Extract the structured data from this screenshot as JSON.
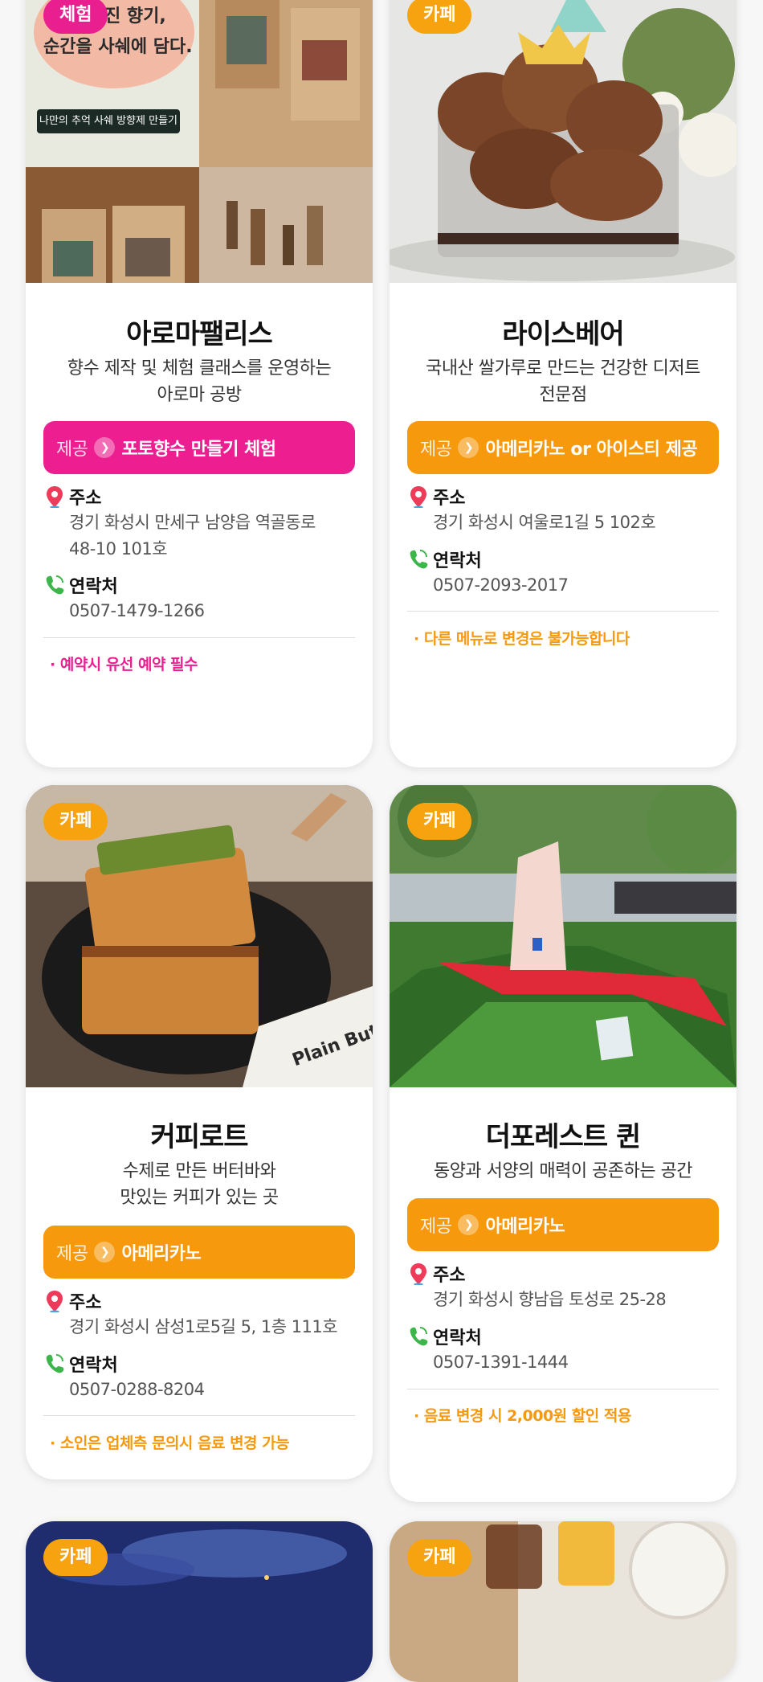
{
  "cards": [
    {
      "tag": "체험",
      "photo_caption_line1": "진 향기,",
      "photo_caption_line2": "순간을 사쉐에 담다.",
      "photo_button": "나만의 추억 사쉐 방향제 만들기",
      "title": "아로마팰리스",
      "desc_line1": "향수 제작 및 체험 클래스를 운영하는",
      "desc_line2": "아로마 공방",
      "offer_label": "제공",
      "offer_text": "포토향수 만들기 체험",
      "address_label": "주소",
      "address_line1": "경기 화성시 만세구 남양읍 역골동로",
      "address_line2": "48-10 101호",
      "contact_label": "연락처",
      "contact": "0507-1479-1266",
      "note": "· 예약시 유선 예약 필수"
    },
    {
      "tag": "카페",
      "title": "라이스베어",
      "desc_line1": "국내산 쌀가루로 만드는 건강한 디저트",
      "desc_line2": "전문점",
      "offer_label": "제공",
      "offer_text": "아메리카노 or 아이스티 제공",
      "address_label": "주소",
      "address_line1": "경기 화성시 여울로1길 5 102호",
      "contact_label": "연락처",
      "contact": "0507-2093-2017",
      "note": "· 다른 메뉴로 변경은 불가능합니다"
    },
    {
      "tag": "카페",
      "photo_text": "Plain Butter Bo",
      "title": "커피로트",
      "desc_line1": "수제로 만든 버터바와",
      "desc_line2": "맛있는 커피가 있는 곳",
      "offer_label": "제공",
      "offer_text": "아메리카노",
      "address_label": "주소",
      "address_line1": "경기 화성시 삼성1로5길 5, 1층 111호",
      "contact_label": "연락처",
      "contact": "0507-0288-8204",
      "note": "· 소인은 업체측 문의시 음료 변경 가능"
    },
    {
      "tag": "카페",
      "title": "더포레스트 퀸",
      "desc_line1": "동양과 서양의 매력이 공존하는 공간",
      "offer_label": "제공",
      "offer_text": "아메리카노",
      "address_label": "주소",
      "address_line1": "경기 화성시 향남읍 토성로 25-28",
      "contact_label": "연락처",
      "contact": "0507-1391-1444",
      "note": "· 음료 변경 시 2,000원 할인 적용"
    },
    {
      "tag": "카페"
    },
    {
      "tag": "카페"
    }
  ],
  "colors": {
    "pink": "#ec1e90",
    "orange": "#f7990d",
    "tag_orange": "#f7a310"
  },
  "icons": {
    "address": "map-pin-icon",
    "contact": "phone-icon",
    "offer_arrow": "chevron-right-icon"
  }
}
